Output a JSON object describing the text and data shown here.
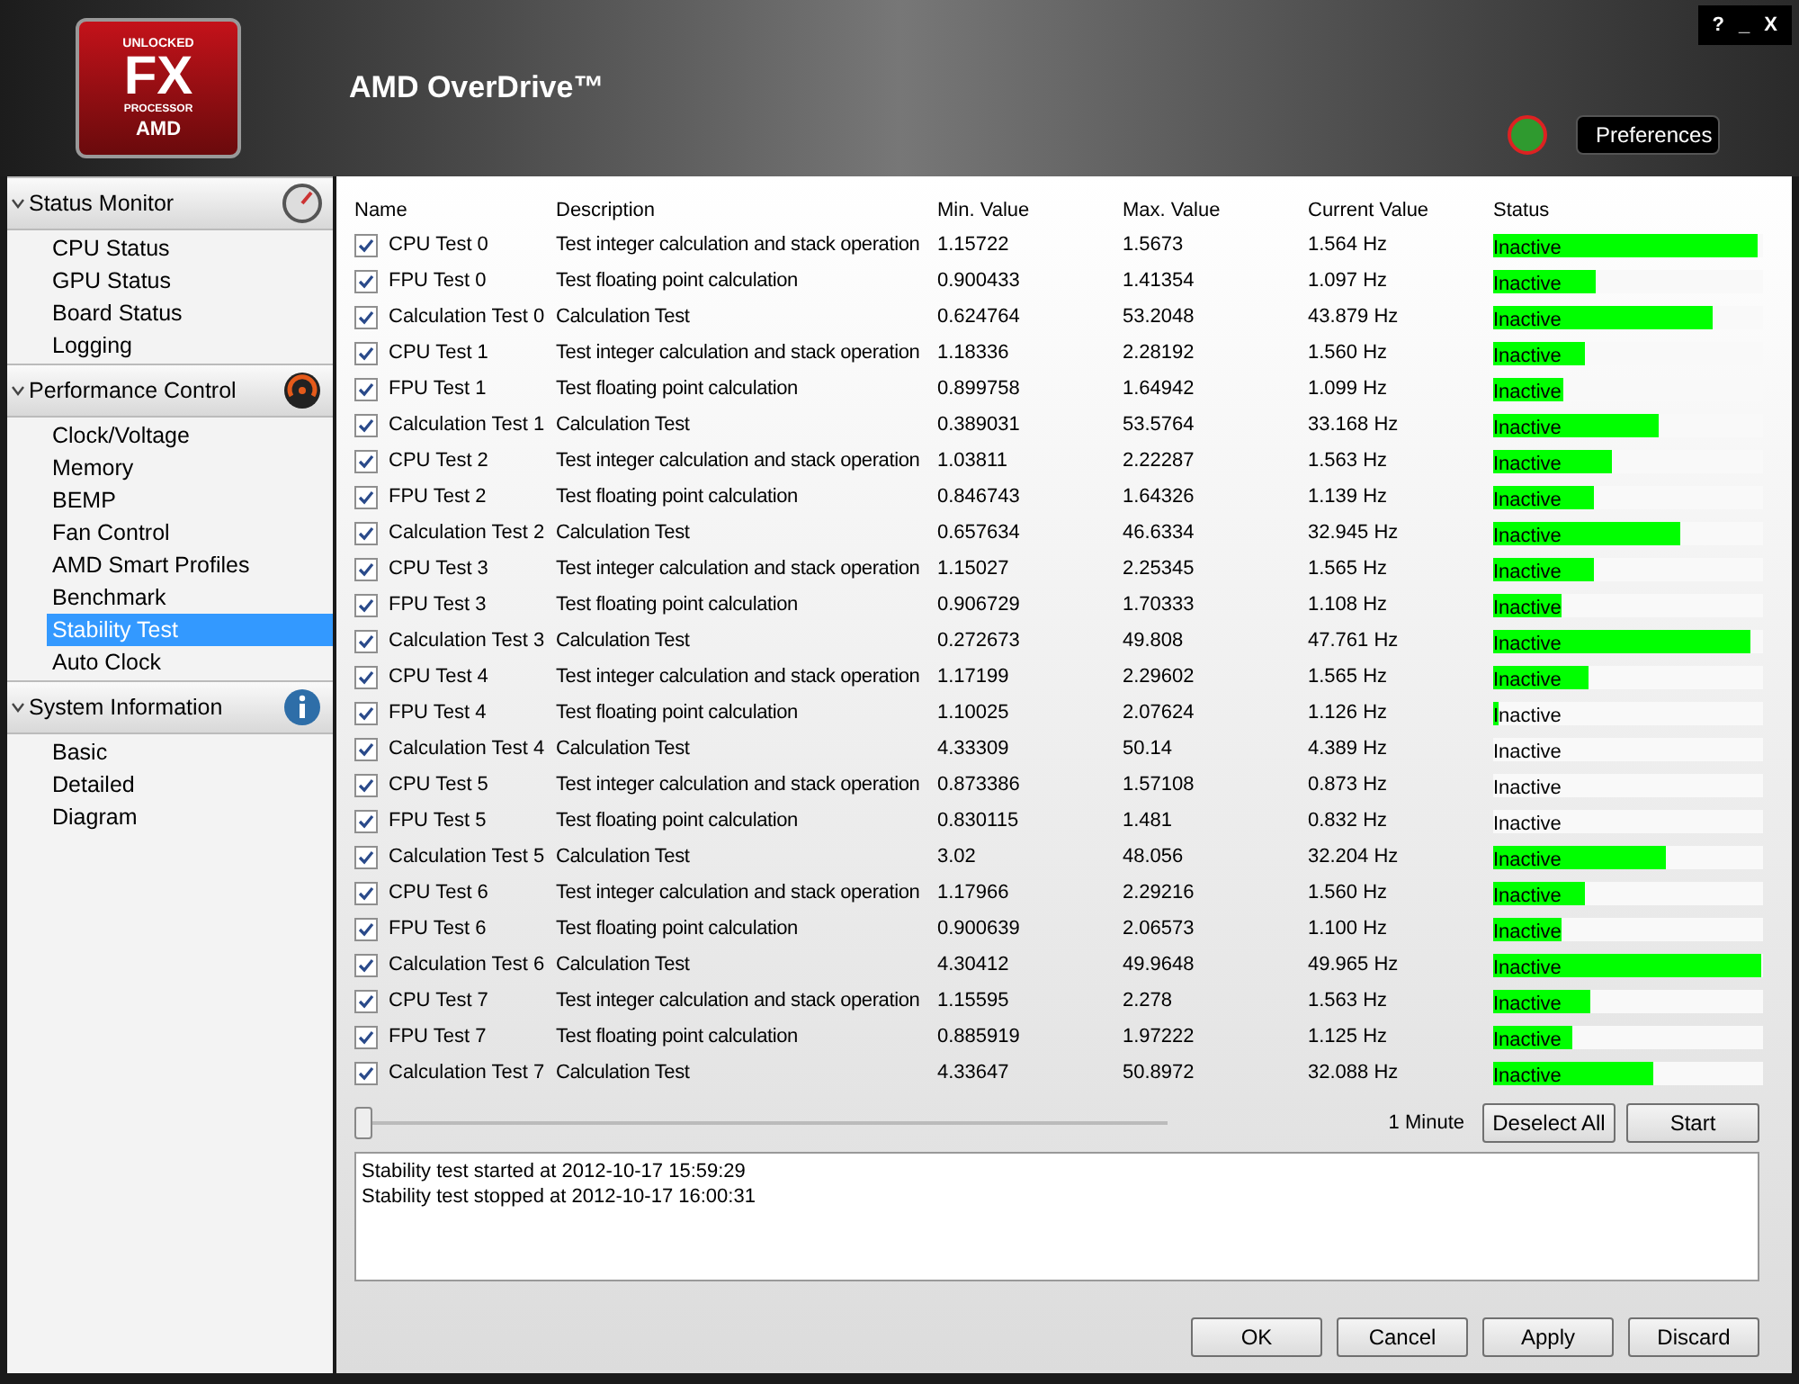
{
  "window": {
    "title": "AMD OverDrive™",
    "controls": [
      "?",
      "_",
      "X"
    ]
  },
  "logo": {
    "top": "UNLOCKED",
    "main": "FX",
    "sub": "PROCESSOR",
    "brand": "AMD"
  },
  "preferences_button": "Preferences",
  "sidebar": [
    {
      "title": "Status Monitor",
      "expanded": true,
      "items": [
        {
          "label": "CPU Status",
          "selected": false
        },
        {
          "label": "GPU Status",
          "selected": false
        },
        {
          "label": "Board Status",
          "selected": false
        },
        {
          "label": "Logging",
          "selected": false
        }
      ]
    },
    {
      "title": "Performance Control",
      "expanded": true,
      "items": [
        {
          "label": "Clock/Voltage",
          "selected": false
        },
        {
          "label": "Memory",
          "selected": false
        },
        {
          "label": "BEMP",
          "selected": false
        },
        {
          "label": "Fan Control",
          "selected": false
        },
        {
          "label": "AMD Smart Profiles",
          "selected": false
        },
        {
          "label": "Benchmark",
          "selected": false
        },
        {
          "label": "Stability Test",
          "selected": true
        },
        {
          "label": "Auto Clock",
          "selected": false
        }
      ]
    },
    {
      "title": "System Information",
      "expanded": true,
      "items": [
        {
          "label": "Basic",
          "selected": false
        },
        {
          "label": "Detailed",
          "selected": false
        },
        {
          "label": "Diagram",
          "selected": false
        }
      ]
    }
  ],
  "table": {
    "columns": [
      "Name",
      "Description",
      "Min. Value",
      "Max. Value",
      "Current Value",
      "Status"
    ],
    "rows": [
      {
        "checked": true,
        "name": "CPU Test 0",
        "description": "Test integer calculation and stack operation",
        "min": "1.15722",
        "max": "1.5673",
        "current": "1.564 Hz",
        "status": "Inactive",
        "level": 0.98
      },
      {
        "checked": true,
        "name": "FPU Test 0",
        "description": "Test floating point calculation",
        "min": "0.900433",
        "max": "1.41354",
        "current": "1.097 Hz",
        "status": "Inactive",
        "level": 0.38
      },
      {
        "checked": true,
        "name": "Calculation Test 0",
        "description": "Calculation Test",
        "min": "0.624764",
        "max": "53.2048",
        "current": "43.879 Hz",
        "status": "Inactive",
        "level": 0.81
      },
      {
        "checked": true,
        "name": "CPU Test 1",
        "description": "Test integer calculation and stack operation",
        "min": "1.18336",
        "max": "2.28192",
        "current": "1.560 Hz",
        "status": "Inactive",
        "level": 0.34
      },
      {
        "checked": true,
        "name": "FPU Test 1",
        "description": "Test floating point calculation",
        "min": "0.899758",
        "max": "1.64942",
        "current": "1.099 Hz",
        "status": "Inactive",
        "level": 0.26
      },
      {
        "checked": true,
        "name": "Calculation Test 1",
        "description": "Calculation Test",
        "min": "0.389031",
        "max": "53.5764",
        "current": "33.168 Hz",
        "status": "Inactive",
        "level": 0.61
      },
      {
        "checked": true,
        "name": "CPU Test 2",
        "description": "Test integer calculation and stack operation",
        "min": "1.03811",
        "max": "2.22287",
        "current": "1.563 Hz",
        "status": "Inactive",
        "level": 0.44
      },
      {
        "checked": true,
        "name": "FPU Test 2",
        "description": "Test floating point calculation",
        "min": "0.846743",
        "max": "1.64326",
        "current": "1.139 Hz",
        "status": "Inactive",
        "level": 0.37
      },
      {
        "checked": true,
        "name": "Calculation Test 2",
        "description": "Calculation Test",
        "min": "0.657634",
        "max": "46.6334",
        "current": "32.945 Hz",
        "status": "Inactive",
        "level": 0.69
      },
      {
        "checked": true,
        "name": "CPU Test 3",
        "description": "Test integer calculation and stack operation",
        "min": "1.15027",
        "max": "2.25345",
        "current": "1.565 Hz",
        "status": "Inactive",
        "level": 0.37
      },
      {
        "checked": true,
        "name": "FPU Test 3",
        "description": "Test floating point calculation",
        "min": "0.906729",
        "max": "1.70333",
        "current": "1.108 Hz",
        "status": "Inactive",
        "level": 0.25
      },
      {
        "checked": true,
        "name": "Calculation Test 3",
        "description": "Calculation Test",
        "min": "0.272673",
        "max": "49.808",
        "current": "47.761 Hz",
        "status": "Inactive",
        "level": 0.95
      },
      {
        "checked": true,
        "name": "CPU Test 4",
        "description": "Test integer calculation and stack operation",
        "min": "1.17199",
        "max": "2.29602",
        "current": "1.565 Hz",
        "status": "Inactive",
        "level": 0.35
      },
      {
        "checked": true,
        "name": "FPU Test 4",
        "description": "Test floating point calculation",
        "min": "1.10025",
        "max": "2.07624",
        "current": "1.126 Hz",
        "status": "Inactive",
        "level": 0.02
      },
      {
        "checked": true,
        "name": "Calculation Test 4",
        "description": "Calculation Test",
        "min": "4.33309",
        "max": "50.14",
        "current": "4.389 Hz",
        "status": "Inactive"
      },
      {
        "checked": true,
        "name": "CPU Test 5",
        "description": "Test integer calculation and stack operation",
        "min": "0.873386",
        "max": "1.57108",
        "current": "0.873 Hz",
        "status": "Inactive"
      },
      {
        "checked": true,
        "name": "FPU Test 5",
        "description": "Test floating point calculation",
        "min": "0.830115",
        "max": "1.481",
        "current": "0.832 Hz",
        "status": "Inactive"
      },
      {
        "checked": true,
        "name": "Calculation Test 5",
        "description": "Calculation Test",
        "min": "3.02",
        "max": "48.056",
        "current": "32.204 Hz",
        "status": "Inactive",
        "level": 0.64
      },
      {
        "checked": true,
        "name": "CPU Test 6",
        "description": "Test integer calculation and stack operation",
        "min": "1.17966",
        "max": "2.29216",
        "current": "1.560 Hz",
        "status": "Inactive",
        "level": 0.34
      },
      {
        "checked": true,
        "name": "FPU Test 6",
        "description": "Test floating point calculation",
        "min": "0.900639",
        "max": "2.06573",
        "current": "1.100 Hz",
        "status": "Inactive",
        "level": 0.25
      },
      {
        "checked": true,
        "name": "Calculation Test 6",
        "description": "Calculation Test",
        "min": "4.30412",
        "max": "49.9648",
        "current": "49.965 Hz",
        "status": "Inactive",
        "level": 0.99
      },
      {
        "checked": true,
        "name": "CPU Test 7",
        "description": "Test integer calculation and stack operation",
        "min": "1.15595",
        "max": "2.278",
        "current": "1.563 Hz",
        "status": "Inactive",
        "level": 0.36
      },
      {
        "checked": true,
        "name": "FPU Test 7",
        "description": "Test floating point calculation",
        "min": "0.885919",
        "max": "1.97222",
        "current": "1.125 Hz",
        "status": "Inactive",
        "level": 0.29
      },
      {
        "checked": true,
        "name": "Calculation Test 7",
        "description": "Calculation Test",
        "min": "4.33647",
        "max": "50.8972",
        "current": "32.088 Hz",
        "status": "Inactive",
        "level": 0.59
      }
    ]
  },
  "duration": {
    "level": 0,
    "reading": "1 Minute"
  },
  "actions": [
    "Deselect All",
    "Start"
  ],
  "log": [
    "Stability test started at 2012-10-17 15:59:29",
    "Stability test stopped at 2012-10-17 16:00:31"
  ],
  "footer_buttons": [
    "OK",
    "Cancel",
    "Apply",
    "Discard"
  ]
}
